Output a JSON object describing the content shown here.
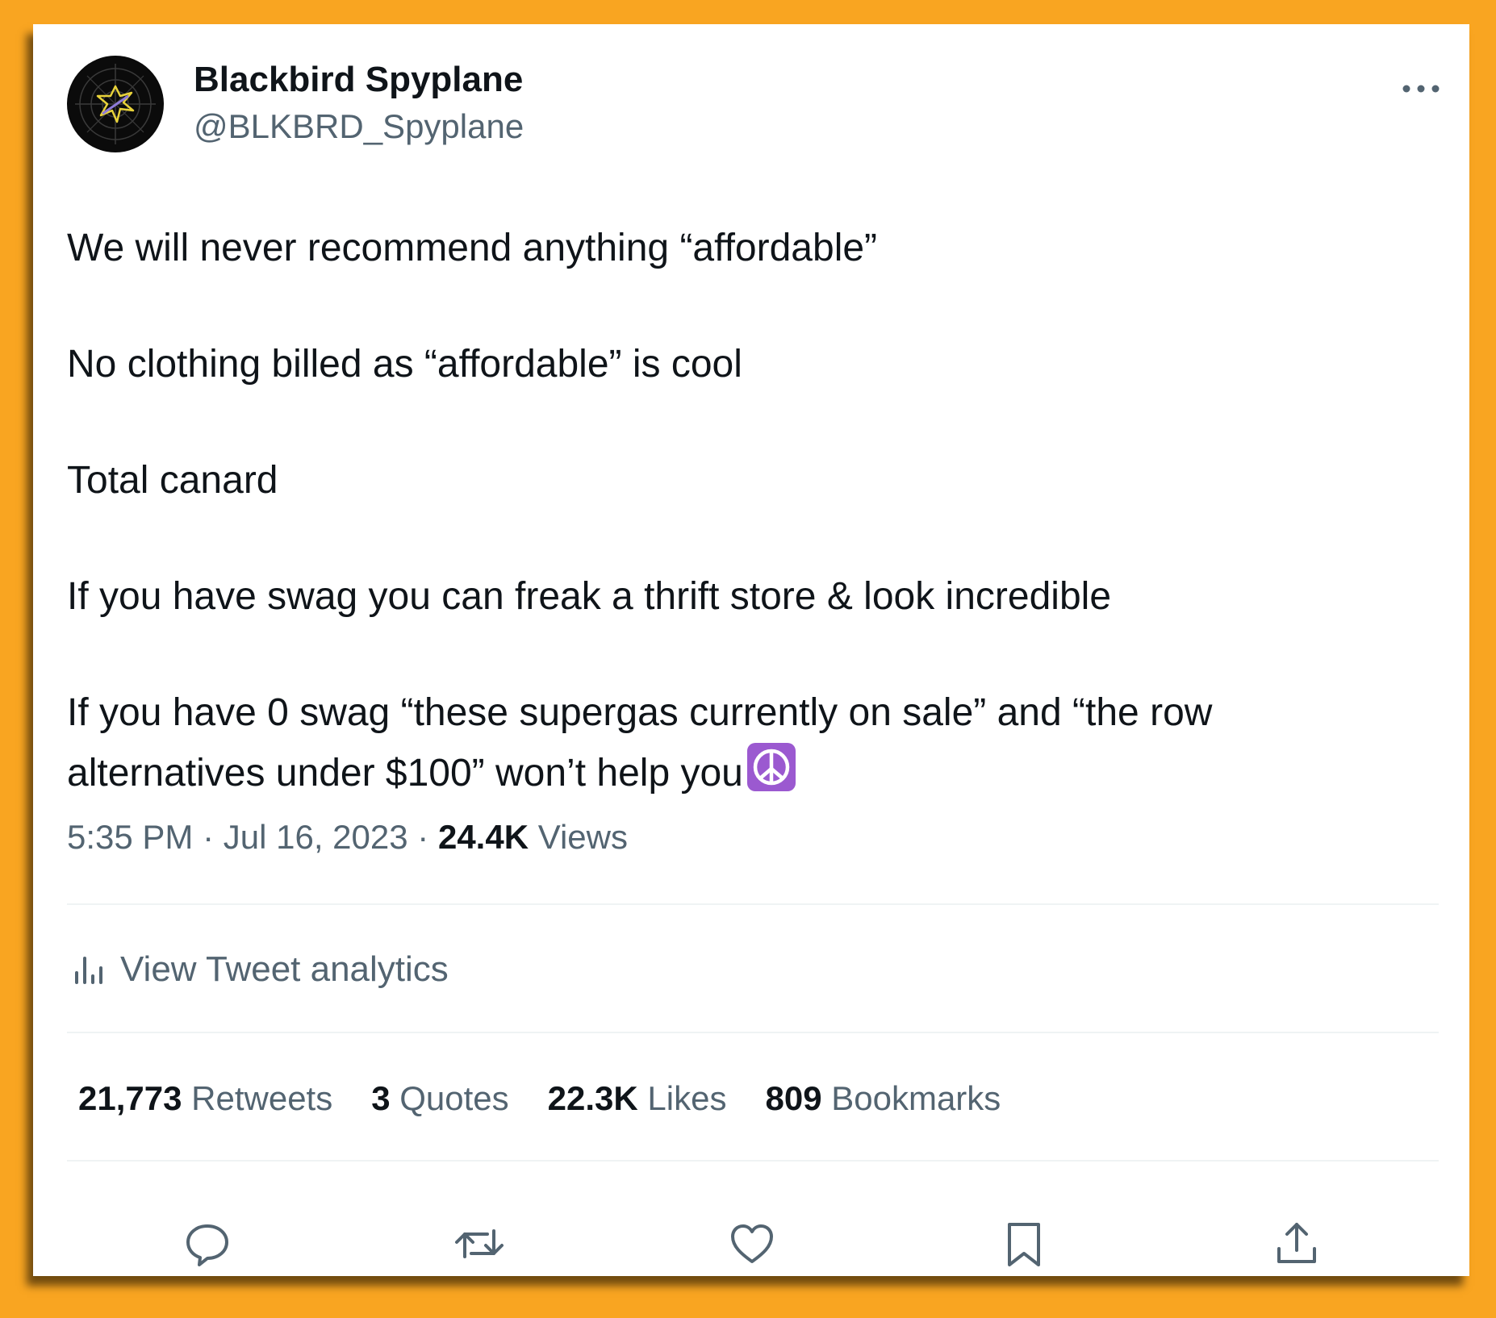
{
  "author": {
    "display_name": "Blackbird Spyplane",
    "handle": "@BLKBRD_Spyplane",
    "avatar_icon": "radar-logo-icon"
  },
  "tweet": {
    "lines": [
      "We will never recommend anything “affordable”",
      "No clothing billed as “affordable” is cool",
      "Total canard",
      "If you have swag you can freak a thrift store & look incredible",
      "If you have 0 swag “these supergas currently on sale” and “the row",
      "alternatives under $100” won’t help you"
    ],
    "emoji": "peace-symbol-emoji"
  },
  "meta": {
    "time": "5:35 PM",
    "separator": "·",
    "date": "Jul 16, 2023",
    "views_count": "24.4K",
    "views_label": "Views"
  },
  "analytics": {
    "label": "View Tweet analytics",
    "icon": "bar-chart-icon"
  },
  "stats": {
    "retweets_count": "21,773",
    "retweets_label": "Retweets",
    "quotes_count": "3",
    "quotes_label": "Quotes",
    "likes_count": "22.3K",
    "likes_label": "Likes",
    "bookmarks_count": "809",
    "bookmarks_label": "Bookmarks"
  },
  "actions": [
    "reply-icon",
    "retweet-icon",
    "like-icon",
    "bookmark-icon",
    "share-icon"
  ],
  "colors": {
    "background": "#f9a521",
    "card": "#ffffff",
    "primary_text": "#0f1419",
    "secondary_text": "#536471",
    "divider": "#eff3f4",
    "emoji_purple": "#9b59d0"
  }
}
